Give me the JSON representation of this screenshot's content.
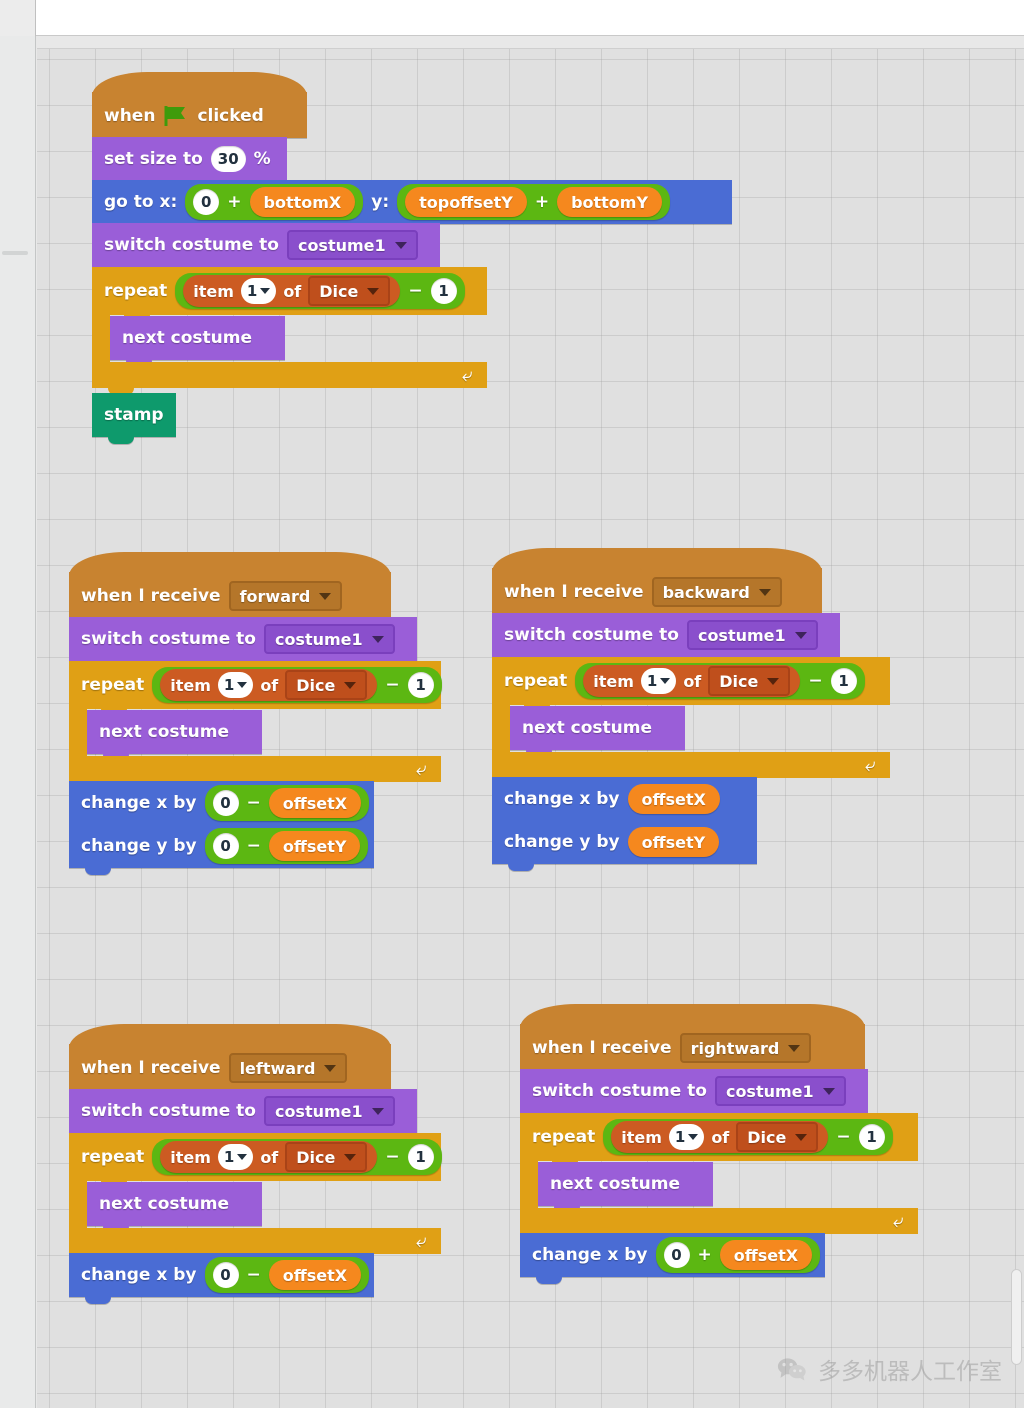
{
  "window": {
    "tab_stub": "S"
  },
  "colors": {
    "motion": "#4a6cd4",
    "looks": "#9a5ed8",
    "control": "#e0a015",
    "events": "#c88330",
    "pen": "#0e9a6c",
    "operators": "#5cb712",
    "variables": "#f5881e",
    "list": "#cc5b22",
    "canvas_bg": "#e0e0e0"
  },
  "labels": {
    "when": "when",
    "clicked": "clicked",
    "when_i_receive": "when I receive",
    "set_size_to": "set size to",
    "percent": "%",
    "go_to_x": "go to x:",
    "y_label": "y:",
    "switch_costume_to": "switch costume to",
    "repeat": "repeat",
    "item": "item",
    "of": "of",
    "next_costume": "next costume",
    "stamp": "stamp",
    "change_x_by": "change x by",
    "change_y_by": "change y by",
    "minus": "−",
    "plus": "+"
  },
  "scripts": {
    "green_flag": {
      "hat": {
        "label_before": "when",
        "icon": "green-flag-icon",
        "label_after": "clicked"
      },
      "set_size": {
        "label": "set size to",
        "value": "30",
        "unit": "%"
      },
      "go_to": {
        "label": "go to x:",
        "x_value": "0",
        "x_op": "+",
        "x_var": "bottomX",
        "y_label": "y:",
        "y_var1": "topoffsetY",
        "y_op": "+",
        "y_var2": "bottomY"
      },
      "switch_costume": {
        "label": "switch costume to",
        "costume": "costume1"
      },
      "repeat": {
        "label": "repeat",
        "item_label": "item",
        "index": "1",
        "of_label": "of",
        "list_name": "Dice",
        "op": "−",
        "operand": "1"
      },
      "body": {
        "next_costume": "next costume"
      },
      "stamp": "stamp"
    },
    "forward": {
      "hat": {
        "label": "when I receive",
        "message": "forward"
      },
      "switch_costume": {
        "label": "switch costume to",
        "costume": "costume1"
      },
      "repeat": {
        "label": "repeat",
        "item_label": "item",
        "index": "1",
        "of_label": "of",
        "list_name": "Dice",
        "op": "−",
        "operand": "1"
      },
      "body": {
        "next_costume": "next costume"
      },
      "change_x": {
        "label": "change x by",
        "value": "0",
        "op": "−",
        "var": "offsetX"
      },
      "change_y": {
        "label": "change y by",
        "value": "0",
        "op": "−",
        "var": "offsetY"
      }
    },
    "backward": {
      "hat": {
        "label": "when I receive",
        "message": "backward"
      },
      "switch_costume": {
        "label": "switch costume to",
        "costume": "costume1"
      },
      "repeat": {
        "label": "repeat",
        "item_label": "item",
        "index": "1",
        "of_label": "of",
        "list_name": "Dice",
        "op": "−",
        "operand": "1"
      },
      "body": {
        "next_costume": "next costume"
      },
      "change_x": {
        "label": "change x by",
        "var": "offsetX"
      },
      "change_y": {
        "label": "change y by",
        "var": "offsetY"
      }
    },
    "leftward": {
      "hat": {
        "label": "when I receive",
        "message": "leftward"
      },
      "switch_costume": {
        "label": "switch costume to",
        "costume": "costume1"
      },
      "repeat": {
        "label": "repeat",
        "item_label": "item",
        "index": "1",
        "of_label": "of",
        "list_name": "Dice",
        "op": "−",
        "operand": "1"
      },
      "body": {
        "next_costume": "next costume"
      },
      "change_x": {
        "label": "change x by",
        "value": "0",
        "op": "−",
        "var": "offsetX"
      }
    },
    "rightward": {
      "hat": {
        "label": "when I receive",
        "message": "rightward"
      },
      "switch_costume": {
        "label": "switch costume to",
        "costume": "costume1"
      },
      "repeat": {
        "label": "repeat",
        "item_label": "item",
        "index": "1",
        "of_label": "of",
        "list_name": "Dice",
        "op": "−",
        "operand": "1"
      },
      "body": {
        "next_costume": "next costume"
      },
      "change_x": {
        "label": "change x by",
        "value": "0",
        "op": "+",
        "var": "offsetX"
      }
    }
  },
  "watermark": {
    "text": "多多机器人工作室",
    "icon": "wechat-icon"
  }
}
